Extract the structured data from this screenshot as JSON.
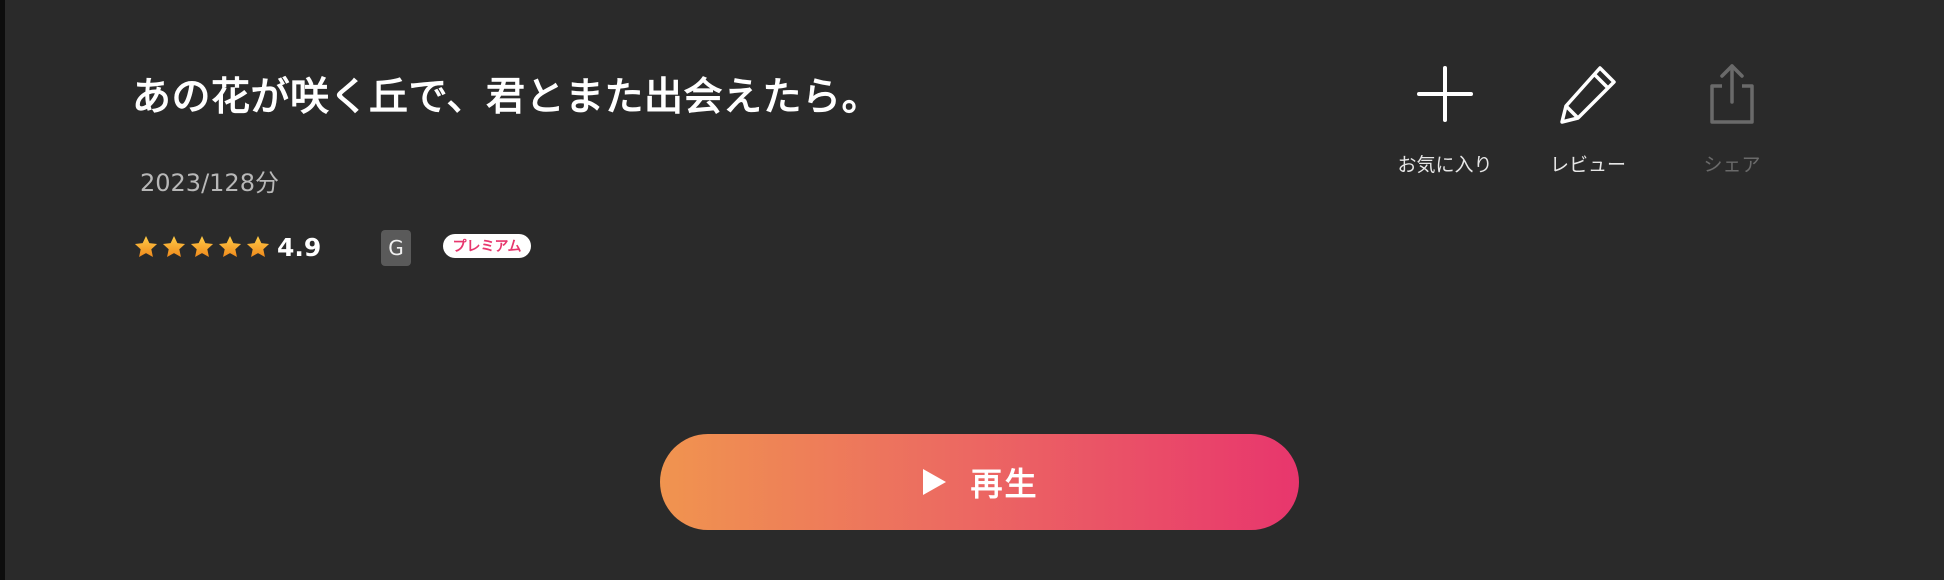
{
  "title": "あの花が咲く丘で、君とまた出会えたら。",
  "meta": "2023/128分",
  "rating": {
    "value": "4.9",
    "stars": 5,
    "star_color": "#f5a524"
  },
  "age_rating": "G",
  "premium_badge": "プレミアム",
  "actions": {
    "favorite": {
      "label": "お気に入り",
      "icon": "plus-icon"
    },
    "review": {
      "label": "レビュー",
      "icon": "pencil-icon"
    },
    "share": {
      "label": "シェア",
      "icon": "share-icon",
      "disabled": true
    }
  },
  "play_button": {
    "label": "再生",
    "icon": "play-icon"
  },
  "colors": {
    "background": "#2a2a2a",
    "accent_start": "#f0944f",
    "accent_end": "#e8366d"
  }
}
